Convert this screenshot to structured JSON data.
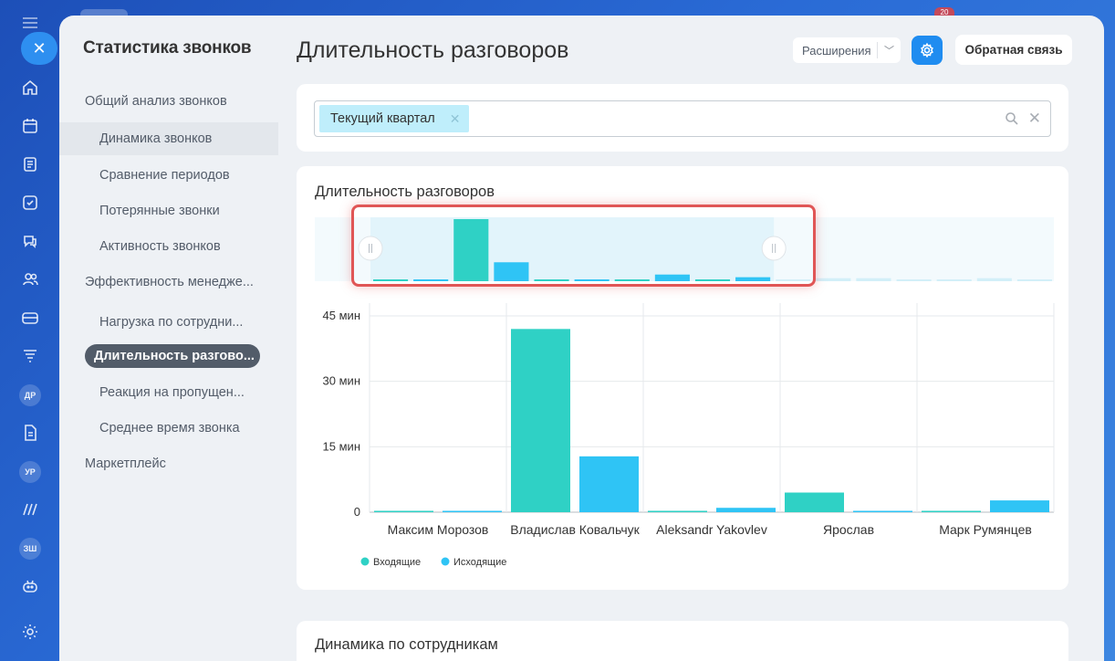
{
  "colors": {
    "incoming": "#2fd1c5",
    "outgoing": "#2fc4f5",
    "accent": "#1f8cf0",
    "highlight": "#e05656"
  },
  "rail": {
    "badge": "20",
    "icons": [
      "close-icon",
      "home-icon",
      "calendar-icon",
      "feed-icon",
      "tasks-icon",
      "chat-icon",
      "contacts-icon",
      "crm-icon",
      "filter-icon",
      "docs-icon",
      "sites-icon",
      "robot-icon",
      "settings-icon"
    ],
    "avatars": [
      "ДР",
      "УР",
      "ЗШ"
    ]
  },
  "sidebar": {
    "title": "Статистика звонков",
    "items": [
      {
        "label": "Общий анализ звонков"
      },
      {
        "label": "Динамика звонков"
      },
      {
        "label": "Сравнение периодов"
      },
      {
        "label": "Потерянные звонки"
      },
      {
        "label": "Активность звонков"
      },
      {
        "label": "Эффективность менедже..."
      },
      {
        "label": "Нагрузка по сотрудни..."
      },
      {
        "label": "Длительность разгово..."
      },
      {
        "label": "Реакция на пропущен..."
      },
      {
        "label": "Среднее время звонка"
      },
      {
        "label": "Маркетплейс"
      }
    ]
  },
  "header": {
    "title": "Длительность разговоров",
    "extensions_label": "Расширения",
    "feedback_label": "Обратная связь"
  },
  "filter": {
    "chip_label": "Текущий квартал"
  },
  "chart_card": {
    "title": "Длительность разговоров"
  },
  "second_card": {
    "title": "Динамика по сотрудникам"
  },
  "chart_data": {
    "type": "bar",
    "categories": [
      "Максим Морозов",
      "Владислав Ковальчук",
      "Aleksandr Yakovlev",
      "Ярослав",
      "Марк Румянцев"
    ],
    "series": [
      {
        "name": "Входящие",
        "values": [
          0,
          42,
          0,
          4.5,
          0
        ]
      },
      {
        "name": "Исходящие",
        "values": [
          0.3,
          12.8,
          1,
          0,
          2.7
        ]
      }
    ],
    "y_tick_labels": [
      "0",
      "15 мин",
      "30 мин",
      "45 мин"
    ],
    "y_ticks": [
      0,
      15,
      30,
      45
    ],
    "ylim": [
      0,
      45
    ],
    "legend_position": "bottom-left",
    "grid": true
  },
  "navigator": {
    "bars": [
      0,
      0.3,
      42,
      12.8,
      0,
      1,
      0,
      4.5,
      0,
      2.7,
      0,
      2,
      2,
      0.5,
      0.5,
      2,
      0.5
    ],
    "selected_count": 10
  }
}
